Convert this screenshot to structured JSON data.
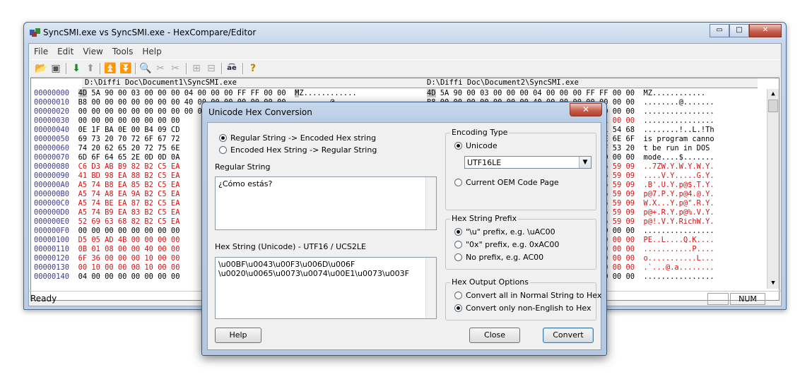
{
  "window": {
    "title": "SyncSMI.exe vs SyncSMI.exe - HexCompare/Editor",
    "minimize": "▭",
    "maximize": "□",
    "close": "✕"
  },
  "menu": [
    "File",
    "Edit",
    "View",
    "Tools",
    "Help"
  ],
  "toolbar_icons": [
    "open-icon",
    "save-icon",
    "next-diff-icon",
    "prev-diff-icon",
    "first-diff-icon",
    "last-diff-icon",
    "find-icon",
    "cut-icon",
    "copy-icon",
    "hex-view-icon",
    "text-view-icon",
    "unicode-convert-icon",
    "help-icon"
  ],
  "left_pane": {
    "path": "D:\\Diffi Doc\\Document1\\SyncSMI.exe",
    "rows": [
      {
        "off": "00000000",
        "hex": "4D 5A 90 00 03 00 00 00 04 00 00 00 FF FF 00 00",
        "ascii": "MZ............",
        "red": false
      },
      {
        "off": "00000010",
        "hex": "B8 00 00 00 00 00 00 00 40 00 00 00 00 00 00 00",
        "ascii": "........@.......",
        "red": false
      },
      {
        "off": "00000020",
        "hex": "00 00 00 00 00 00 00 00 00 00 00 00 00 00 00 00",
        "ascii": "",
        "red": false
      },
      {
        "off": "00000030",
        "hex": "00 00 00 00 00 00 00 00",
        "ascii": "",
        "red": false
      },
      {
        "off": "00000040",
        "hex": "0E 1F BA 0E 00 B4 09 CD",
        "ascii": "",
        "red": false
      },
      {
        "off": "00000050",
        "hex": "69 73 20 70 72 6F 67 72",
        "ascii": "",
        "red": false
      },
      {
        "off": "00000060",
        "hex": "74 20 62 65 20 72 75 6E",
        "ascii": "",
        "red": false
      },
      {
        "off": "00000070",
        "hex": "6D 6F 64 65 2E 0D 0D 0A",
        "ascii": "",
        "red": false
      },
      {
        "off": "00000080",
        "hex": "C6 D3 AB B9 82 B2 C5 EA",
        "ascii": "",
        "red": true
      },
      {
        "off": "00000090",
        "hex": "41 BD 98 EA 88 B2 C5 EA",
        "ascii": "",
        "red": true
      },
      {
        "off": "000000A0",
        "hex": "A5 74 B8 EA 85 B2 C5 EA",
        "ascii": "",
        "red": true
      },
      {
        "off": "000000B0",
        "hex": "A5 74 A8 EA 9A B2 C5 EA",
        "ascii": "",
        "red": true
      },
      {
        "off": "000000C0",
        "hex": "A5 74 BE EA 87 B2 C5 EA",
        "ascii": "",
        "red": true
      },
      {
        "off": "000000D0",
        "hex": "A5 74 B9 EA 83 B2 C5 EA",
        "ascii": "",
        "red": true
      },
      {
        "off": "000000E0",
        "hex": "52 69 63 68 82 B2 C5 EA",
        "ascii": "",
        "red": true
      },
      {
        "off": "000000F0",
        "hex": "00 00 00 00 00 00 00 00",
        "ascii": "",
        "red": false
      },
      {
        "off": "00000100",
        "hex": "D5 05 AD 4B 00 00 00 00",
        "ascii": "",
        "red": true
      },
      {
        "off": "00000110",
        "hex": "0B 01 08 00 00 40 00 00",
        "ascii": "",
        "red": true
      },
      {
        "off": "00000120",
        "hex": "6F 36 00 00 00 10 00 00",
        "ascii": "",
        "red": true
      },
      {
        "off": "00000130",
        "hex": "00 10 00 00 00 10 00 00",
        "ascii": "",
        "red": true
      },
      {
        "off": "00000140",
        "hex": "04 00 00 00 00 00 00 00",
        "ascii": "",
        "red": false
      }
    ]
  },
  "right_pane": {
    "path": "D:\\Diffi Doc\\Document2\\SyncSMI.exe",
    "rows": [
      {
        "hex": "4D 5A 90 00 03 00 00 00 04 00 00 00 FF FF 00 00",
        "ascii": "MZ............",
        "red": false
      },
      {
        "hex": "B8 00 00 00 00 00 00 00 40 00 00 00 00 00 00 00",
        "ascii": "........@.......",
        "red": false
      },
      {
        "hex": "00 00 00",
        "ascii": "................",
        "red": false
      },
      {
        "hex": "00 01 00 00",
        "ascii": "................",
        "red": false,
        "redtail": true
      },
      {
        "hex": "ED 21 54 68",
        "ascii": "........!..L.!Th",
        "red": false
      },
      {
        "hex": "61 6E 6E 6F",
        "ascii": "is program canno",
        "red": false
      },
      {
        "hex": "44 4F 53 20",
        "ascii": "t be run in DOS ",
        "red": false
      },
      {
        "hex": "00 00 00 00",
        "ascii": "mode....$.......",
        "red": false
      },
      {
        "hex": "57 86 59 09",
        "ascii": "..7ZW.Y.W.Y.W.Y.",
        "red": true
      },
      {
        "hex": "47 86 59 09",
        "ascii": "....V.Y.....G.Y.",
        "red": true
      },
      {
        "hex": "24 86 59 09",
        "ascii": ".B'.U.Y.p@$.T.Y.",
        "red": true
      },
      {
        "hex": "40 86 59 09",
        "ascii": "p@7.P.Y.p@4.@.Y.",
        "red": true
      },
      {
        "hex": "52 86 59 09",
        "ascii": "W.X...Y.p@\".R.Y.",
        "red": true
      },
      {
        "hex": "56 86 59 09",
        "ascii": "p@+.R.Y.p@%.V.Y.",
        "red": true
      },
      {
        "hex": "52 86 59 09",
        "ascii": "p@!.V.Y.RichW.Y.",
        "red": true
      },
      {
        "hex": "00 00 00 00",
        "ascii": "................",
        "red": false
      },
      {
        "hex": "00 00 00 00",
        "ascii": "PE..L....Q.K....",
        "red": true
      },
      {
        "hex": "50 00 00 00",
        "ascii": "...........P....",
        "red": true
      },
      {
        "hex": "10 00 00 00",
        "ascii": "o...........L...",
        "red": true
      },
      {
        "hex": "10 00 00 00",
        "ascii": ".`...@.a........",
        "red": true
      },
      {
        "hex": "00 00 00 00",
        "ascii": "................",
        "red": false
      }
    ]
  },
  "status": {
    "text": "Ready",
    "num": "NUM"
  },
  "dialog": {
    "title": "Unicode Hex Conversion",
    "close": "✕",
    "mode_options": [
      "Regular String -> Encoded Hex string",
      "Encoded Hex String -> Regular String"
    ],
    "regular_string_label": "Regular String",
    "regular_string_value": "¿Cómo estás?",
    "hex_string_label": "Hex String (Unicode) - UTF16 / UCS2LE",
    "hex_string_value": "\\u00BF\\u0043\\u00F3\\u006D\\u006F\n\\u0020\\u0065\\u0073\\u0074\\u00E1\\u0073\\u003F",
    "encoding_group": "Encoding Type",
    "encoding_unicode": "Unicode",
    "encoding_select": "UTF16LE",
    "encoding_oem": "Current OEM Code Page",
    "prefix_group": "Hex String Prefix",
    "prefix_options": [
      "\"\\u\" prefix, e.g. \\uAC00",
      "\"0x\" prefix, e.g. 0xAC00",
      "No prefix, e.g. AC00"
    ],
    "output_group": "Hex Output Options",
    "output_options": [
      "Convert all in Normal String to Hex",
      "Convert only non-English to Hex"
    ],
    "help_button": "Help",
    "close_button": "Close",
    "convert_button": "Convert"
  }
}
